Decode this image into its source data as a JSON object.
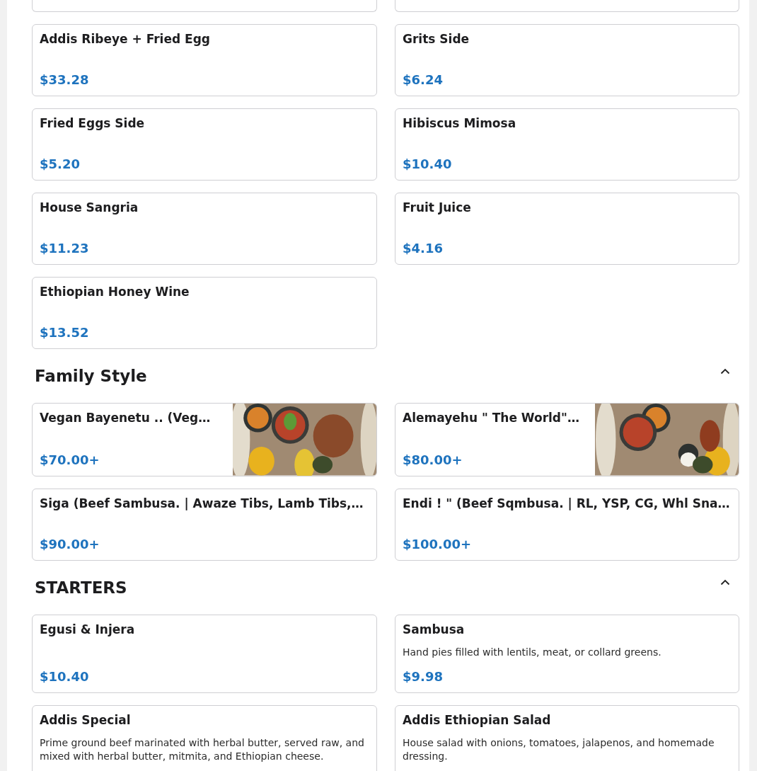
{
  "sections": [
    {
      "items": [
        {
          "kind": "cut"
        },
        {
          "kind": "cut"
        },
        {
          "kind": "plain",
          "name": "Addis Ribeye + Fried Egg",
          "price": "$33.28"
        },
        {
          "kind": "plain",
          "name": "Grits Side",
          "price": "$6.24"
        },
        {
          "kind": "plain",
          "name": "Fried Eggs Side",
          "price": "$5.20"
        },
        {
          "kind": "plain",
          "name": "Hibiscus Mimosa",
          "price": "$10.40"
        },
        {
          "kind": "plain",
          "name": "House Sangria",
          "price": "$11.23"
        },
        {
          "kind": "plain",
          "name": "Fruit Juice",
          "price": "$4.16"
        },
        {
          "kind": "plain",
          "name": "Ethiopian Honey Wine",
          "price": "$13.52"
        }
      ]
    },
    {
      "title": "Family Style",
      "expanded": true,
      "items": [
        {
          "name": "Vegan Bayenetu .. (Veg…",
          "price": "$70.00+"
        },
        {
          "name": "Alemayehu \" The World\"…",
          "price": "$80.00+"
        },
        {
          "kind": "plain",
          "name": "Siga (Beef Sambusa. | Awaze Tibs, Lamb Tibs,…",
          "price": "$90.00+"
        },
        {
          "kind": "plain",
          "name": "Endi ! \" (Beef Sqmbusa. | RL, YSP, CG, Whl Sna…",
          "price": "$100.00+"
        }
      ]
    },
    {
      "title": "STARTERS",
      "expanded": true,
      "items": [
        {
          "kind": "plain",
          "name": "Egusi & Injera",
          "price": "$10.40"
        },
        {
          "kind": "plain",
          "name": "Sambusa",
          "description": "Hand pies filled with lentils, meat, or collard greens.",
          "price": "$9.98"
        },
        {
          "kind": "plain",
          "name": "Addis Special",
          "description": "Prime ground beef marinated with herbal butter, served raw, and mixed with herbal butter, mitmita, and Ethiopian cheese."
        },
        {
          "kind": "plain",
          "name": "Addis Ethiopian Salad",
          "description": "House salad with onions, tomatoes, jalapenos, and homemade dressing."
        }
      ]
    }
  ]
}
